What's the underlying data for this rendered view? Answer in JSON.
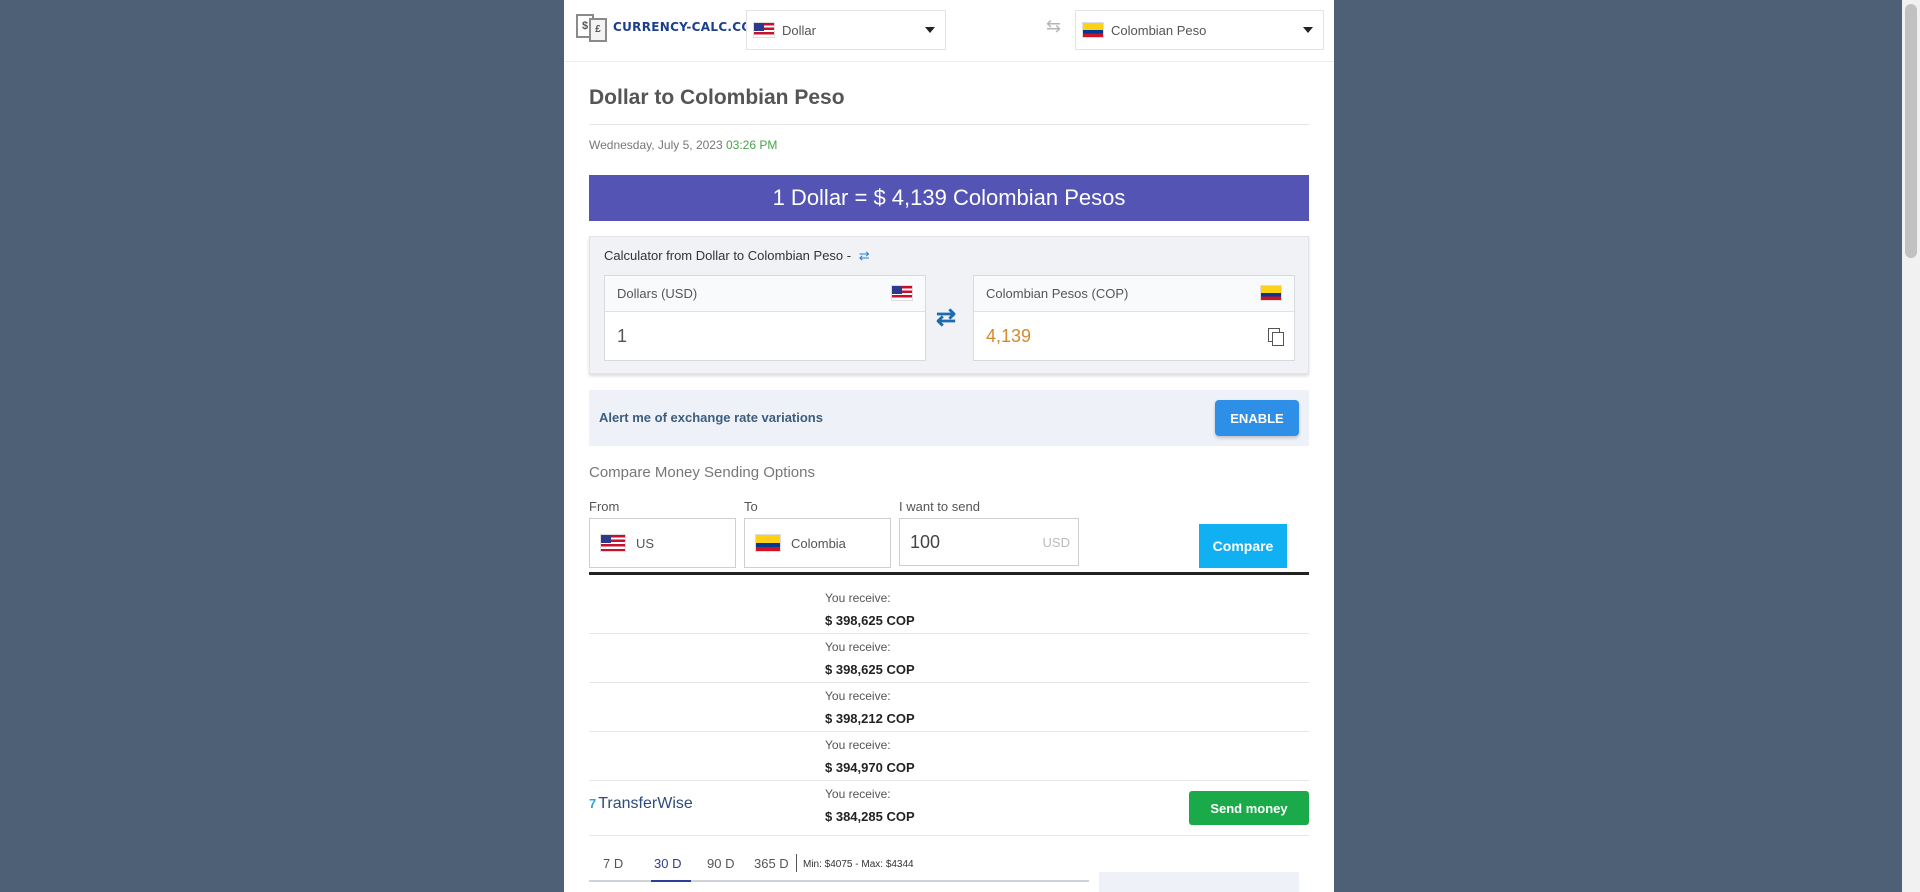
{
  "header": {
    "logo_text": "CURRENCY-CALC.COM",
    "logo_note1": "$",
    "logo_note2": "£",
    "from_currency": "Dollar",
    "to_currency": "Colombian Peso",
    "swap_glyph": "⇆"
  },
  "title": "Dollar to Colombian Peso",
  "date": {
    "day": "Wednesday, July 5, 2023",
    "time": "03:26 PM"
  },
  "rate_banner": "1 Dollar = $ 4,139 Colombian Pesos",
  "calculator": {
    "title": "Calculator from Dollar to Colombian Peso -",
    "title_icon": "⇄",
    "from_label": "Dollars (USD)",
    "from_value": "1",
    "to_label": "Colombian Pesos (COP)",
    "to_value": "4,139",
    "swap_glyph": "⇄"
  },
  "alert": {
    "text": "Alert me of exchange rate variations",
    "button": "ENABLE"
  },
  "compare": {
    "heading": "Compare Money Sending Options",
    "from_label": "From",
    "from_value": "US",
    "to_label": "To",
    "to_value": "Colombia",
    "send_label": "I want to send",
    "send_value": "100",
    "send_unit": "USD",
    "button": "Compare"
  },
  "results": [
    {
      "label": "You receive:",
      "value": "$ 398,625 COP"
    },
    {
      "label": "You receive:",
      "value": "$ 398,625 COP"
    },
    {
      "label": "You receive:",
      "value": "$ 398,212 COP"
    },
    {
      "label": "You receive:",
      "value": "$ 394,970 COP"
    },
    {
      "label": "You receive:",
      "value": "$ 384,285 COP",
      "provider": "TransferWise",
      "provider_mark": "7",
      "button": "Send money"
    }
  ],
  "range": {
    "tabs": [
      "7 D",
      "30 D",
      "90 D",
      "365 D"
    ],
    "active": "30 D",
    "minmax": "Min: $4075 - Max: $4344"
  },
  "colors": {
    "banner": "#5454b4",
    "enable": "#2d8fe6",
    "compare": "#11b0f2",
    "send": "#1aaa4a",
    "background": "#4e6076"
  }
}
